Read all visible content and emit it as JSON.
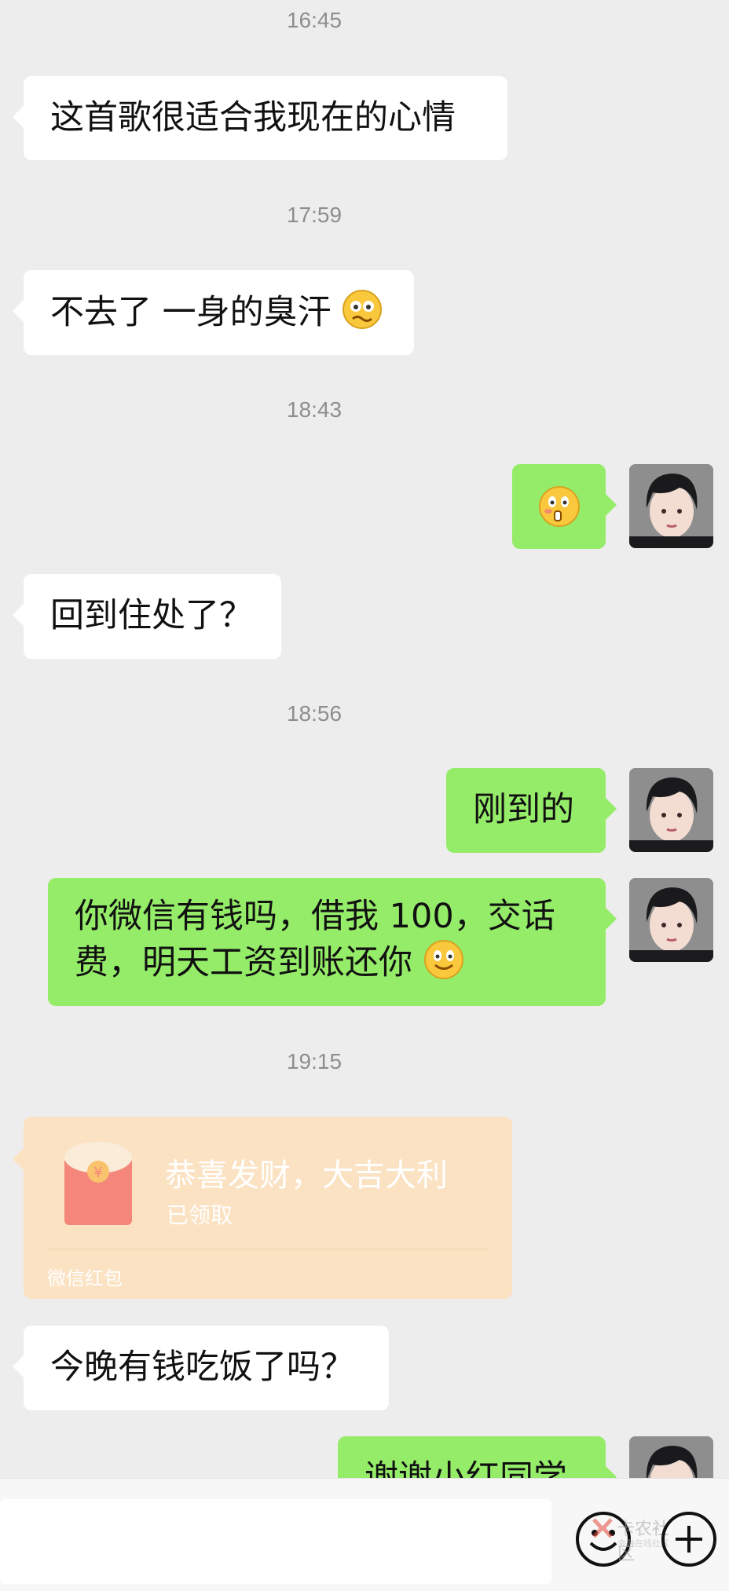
{
  "messages": {
    "ts1": "16:45",
    "msg1": "这首歌很适合我现在的心情",
    "ts2": "17:59",
    "msg2": "不去了 一身的臭汗",
    "ts3": "18:43",
    "msg4": "回到住处了？",
    "ts4": "18:56",
    "msg5": "刚到的",
    "msg6_line1": "你微信有钱吗，借我 100，交话",
    "msg6_line2": "费，明天工资到账还你",
    "ts5": "19:15",
    "msg7": "今晚有钱吃饭了吗？",
    "msg8": "谢谢小红同学"
  },
  "red_packet": {
    "title": "恭喜发财，大吉大利",
    "status": "已领取",
    "footer": "微信红包",
    "symbol": "¥"
  },
  "watermark": {
    "text1": "卡农社区",
    "text2": "金融在线社区"
  },
  "icons": {
    "emoji_button": "emoji-icon",
    "plus_button": "plus-icon"
  },
  "colors": {
    "background": "#ededed",
    "sent_bubble": "#95ec69",
    "received_bubble": "#ffffff",
    "red_packet_bg": "#fbe2c3",
    "red_packet_envelope": "#f5867c"
  }
}
